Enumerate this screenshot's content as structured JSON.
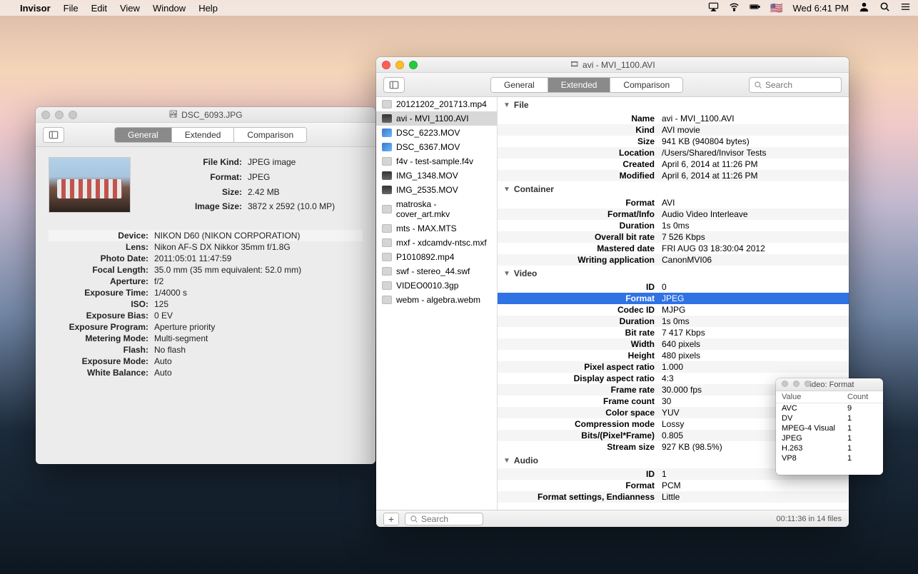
{
  "menubar": {
    "app": "Invisor",
    "menus": [
      "File",
      "Edit",
      "View",
      "Window",
      "Help"
    ],
    "clock": "Wed 6:41 PM"
  },
  "win_jpeg": {
    "title": "DSC_6093.JPG",
    "tabs": {
      "general": "General",
      "extended": "Extended",
      "comparison": "Comparison"
    },
    "top": {
      "file_kind_k": "File Kind:",
      "file_kind_v": "JPEG image",
      "format_k": "Format:",
      "format_v": "JPEG",
      "size_k": "Size:",
      "size_v": "2.42 MB",
      "image_size_k": "Image Size:",
      "image_size_v": "3872 x 2592 (10.0 MP)"
    },
    "detail": [
      {
        "k": "Device:",
        "v": "NIKON D60 (NIKON CORPORATION)",
        "hl": true
      },
      {
        "k": "Lens:",
        "v": "Nikon AF-S DX Nikkor 35mm f/1.8G"
      },
      {
        "k": "Photo Date:",
        "v": "2011:05:01 11:47:59"
      },
      {
        "k": "Focal Length:",
        "v": "35.0 mm (35 mm equivalent: 52.0 mm)"
      },
      {
        "k": "Aperture:",
        "v": "f/2"
      },
      {
        "k": "Exposure Time:",
        "v": "1/4000 s"
      },
      {
        "k": "ISO:",
        "v": "125"
      },
      {
        "k": "Exposure Bias:",
        "v": "0 EV"
      },
      {
        "k": "Exposure Program:",
        "v": "Aperture priority"
      },
      {
        "k": "Metering Mode:",
        "v": "Multi-segment"
      },
      {
        "k": "Flash:",
        "v": "No flash"
      },
      {
        "k": "Exposure Mode:",
        "v": "Auto"
      },
      {
        "k": "White Balance:",
        "v": "Auto"
      }
    ]
  },
  "win_avi": {
    "title": "avi - MVI_1100.AVI",
    "tabs": {
      "general": "General",
      "extended": "Extended",
      "comparison": "Comparison"
    },
    "search_placeholder": "Search",
    "files": [
      {
        "name": "20121202_201713.mp4",
        "icon": "doc"
      },
      {
        "name": "avi - MVI_1100.AVI",
        "icon": "film",
        "sel": true
      },
      {
        "name": "DSC_6223.MOV",
        "icon": "mov"
      },
      {
        "name": "DSC_6367.MOV",
        "icon": "mov"
      },
      {
        "name": "f4v - test-sample.f4v",
        "icon": "doc"
      },
      {
        "name": "IMG_1348.MOV",
        "icon": "film"
      },
      {
        "name": "IMG_2535.MOV",
        "icon": "film"
      },
      {
        "name": "matroska - cover_art.mkv",
        "icon": "doc"
      },
      {
        "name": "mts - MAX.MTS",
        "icon": "doc"
      },
      {
        "name": "mxf - xdcamdv-ntsc.mxf",
        "icon": "doc"
      },
      {
        "name": "P1010892.mp4",
        "icon": "doc"
      },
      {
        "name": "swf - stereo_44.swf",
        "icon": "doc"
      },
      {
        "name": "VIDEO0010.3gp",
        "icon": "doc"
      },
      {
        "name": "webm - algebra.webm",
        "icon": "doc"
      }
    ],
    "groups": {
      "file": {
        "label": "File",
        "rows": [
          {
            "k": "Name",
            "v": "avi - MVI_1100.AVI"
          },
          {
            "k": "Kind",
            "v": "AVI movie"
          },
          {
            "k": "Size",
            "v": "941 KB (940804 bytes)"
          },
          {
            "k": "Location",
            "v": "/Users/Shared/Invisor Tests"
          },
          {
            "k": "Created",
            "v": "April 6, 2014 at 11:26 PM"
          },
          {
            "k": "Modified",
            "v": "April 6, 2014 at 11:26 PM"
          }
        ]
      },
      "container": {
        "label": "Container",
        "rows": [
          {
            "k": "Format",
            "v": "AVI"
          },
          {
            "k": "Format/Info",
            "v": "Audio Video Interleave"
          },
          {
            "k": "Duration",
            "v": "1s 0ms"
          },
          {
            "k": "Overall bit rate",
            "v": "7 526 Kbps"
          },
          {
            "k": "Mastered date",
            "v": "FRI AUG 03 18:30:04 2012"
          },
          {
            "k": "Writing application",
            "v": "CanonMVI06"
          }
        ]
      },
      "video": {
        "label": "Video",
        "rows": [
          {
            "k": "ID",
            "v": "0"
          },
          {
            "k": "Format",
            "v": "JPEG",
            "sel": true
          },
          {
            "k": "Codec ID",
            "v": "MJPG"
          },
          {
            "k": "Duration",
            "v": "1s 0ms"
          },
          {
            "k": "Bit rate",
            "v": "7 417 Kbps"
          },
          {
            "k": "Width",
            "v": "640 pixels"
          },
          {
            "k": "Height",
            "v": "480 pixels"
          },
          {
            "k": "Pixel aspect ratio",
            "v": "1.000"
          },
          {
            "k": "Display aspect ratio",
            "v": "4:3"
          },
          {
            "k": "Frame rate",
            "v": "30.000 fps"
          },
          {
            "k": "Frame count",
            "v": "30"
          },
          {
            "k": "Color space",
            "v": "YUV"
          },
          {
            "k": "Compression mode",
            "v": "Lossy"
          },
          {
            "k": "Bits/(Pixel*Frame)",
            "v": "0.805"
          },
          {
            "k": "Stream size",
            "v": "927 KB (98.5%)"
          }
        ]
      },
      "audio": {
        "label": "Audio",
        "rows": [
          {
            "k": "ID",
            "v": "1"
          },
          {
            "k": "Format",
            "v": "PCM"
          },
          {
            "k": "Format settings, Endianness",
            "v": "Little"
          }
        ]
      }
    },
    "footer": {
      "plus": "+",
      "search_placeholder": "Search",
      "status": "00:11:36 in 14 files"
    }
  },
  "popover": {
    "title": "Video: Format",
    "head": {
      "value": "Value",
      "count": "Count"
    },
    "rows": [
      {
        "v": "AVC",
        "c": "9"
      },
      {
        "v": "DV",
        "c": "1"
      },
      {
        "v": "MPEG-4 Visual",
        "c": "1"
      },
      {
        "v": "JPEG",
        "c": "1"
      },
      {
        "v": "H.263",
        "c": "1"
      },
      {
        "v": "VP8",
        "c": "1"
      }
    ]
  }
}
